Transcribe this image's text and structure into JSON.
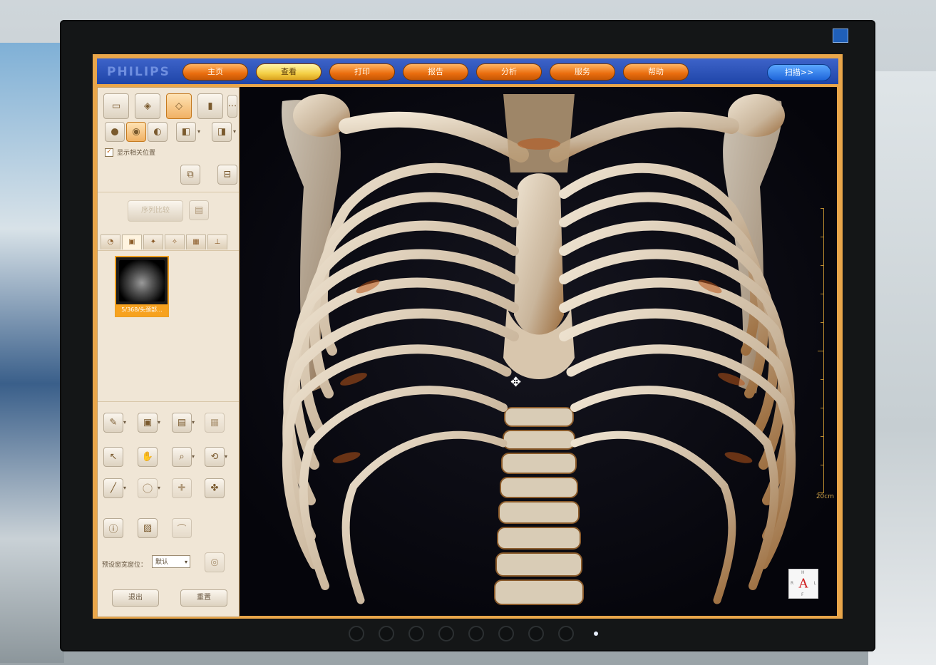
{
  "app": {
    "brand": "PHILIPS"
  },
  "nav": {
    "tabs": [
      {
        "label": "主页",
        "active": false
      },
      {
        "label": "查看",
        "active": true
      },
      {
        "label": "打印",
        "active": false
      },
      {
        "label": "报告",
        "active": false
      },
      {
        "label": "分析",
        "active": false
      },
      {
        "label": "服务",
        "active": false
      },
      {
        "label": "帮助",
        "active": false
      }
    ],
    "scan_button": "扫描>>"
  },
  "left_panel": {
    "show_position_checkbox": {
      "label": "显示相关位置",
      "checked": true
    },
    "sort_button": "序列比较",
    "series": {
      "label": "5/368/头颈部..."
    },
    "preset": {
      "label": "预设窗宽窗位：",
      "value": "默认"
    },
    "exit_button": "退出",
    "reset_button": "重置"
  },
  "viewport": {
    "scale_label": "20cm",
    "orientation": {
      "center": "A",
      "top": "H",
      "bottom": "F",
      "left": "R",
      "right": "L"
    }
  },
  "icons": {
    "check": "✓",
    "chevron": "▾",
    "cursor": "✥",
    "view": [
      "▭",
      "◈",
      "◇",
      "▮",
      "⋯"
    ],
    "render": [
      "●",
      "◉",
      "◐",
      "◧",
      "◨"
    ],
    "tools": [
      "✎",
      "▣",
      "▤",
      "▦",
      "↖",
      "✋",
      "⌕",
      "⟲",
      "╱",
      "◯",
      "✚",
      "✤",
      "ⓘ",
      "▨",
      "⌒",
      "◎",
      "⧉",
      "⊟"
    ],
    "subtabs": [
      "◔",
      "▣",
      "✦",
      "✧",
      "▦",
      "⊥"
    ]
  },
  "colors": {
    "accent": "#e9a64a",
    "nav_bar": "#1f45a8",
    "active_tab": "#f4cf45",
    "series_highlight": "#f7a21f"
  }
}
